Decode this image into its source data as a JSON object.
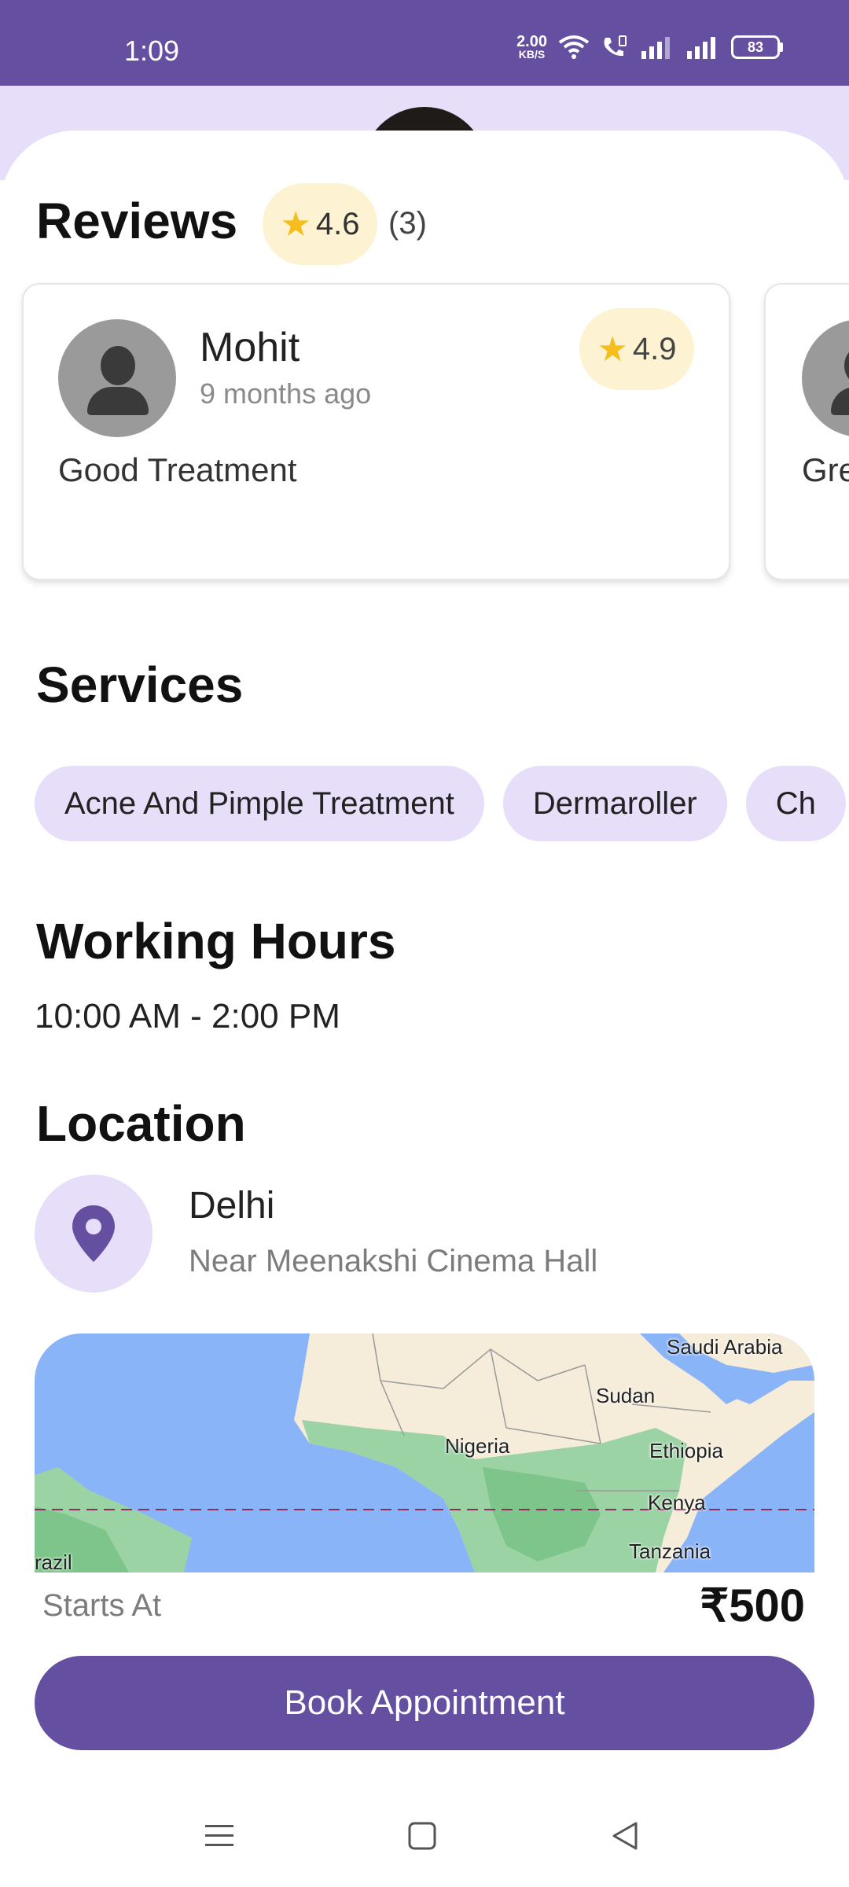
{
  "status_bar": {
    "time": "1:09",
    "net_speed_value": "2.00",
    "net_speed_unit": "KB/S",
    "battery_level": "83",
    "icons": [
      "wifi-icon",
      "wifi-call-icon",
      "signal-icon",
      "signal-icon",
      "battery-icon"
    ]
  },
  "reviews": {
    "title": "Reviews",
    "average_rating": "4.6",
    "count": "(3)",
    "items": [
      {
        "name": "Mohit",
        "time": "9 months ago",
        "rating": "4.9",
        "text": "Good Treatment"
      },
      {
        "text": "Gre"
      }
    ]
  },
  "services": {
    "title": "Services",
    "items": [
      "Acne And Pimple Treatment",
      "Dermaroller",
      "Ch"
    ]
  },
  "working_hours": {
    "title": "Working Hours",
    "value": "10:00 AM - 2:00 PM"
  },
  "location": {
    "title": "Location",
    "city": "Delhi",
    "address": "Near Meenakshi Cinema Hall",
    "map_labels": [
      "Saudi Arabia",
      "Sudan",
      "Nigeria",
      "Ethiopia",
      "Kenya",
      "Tanzania",
      "razil"
    ]
  },
  "booking": {
    "starts_label": "Starts At",
    "price": "₹500",
    "button_label": "Book Appointment"
  },
  "colors": {
    "primary": "#654fa1",
    "lavender": "#e7defa",
    "rating_bg": "#fdf3d3",
    "star": "#f5be1c"
  }
}
